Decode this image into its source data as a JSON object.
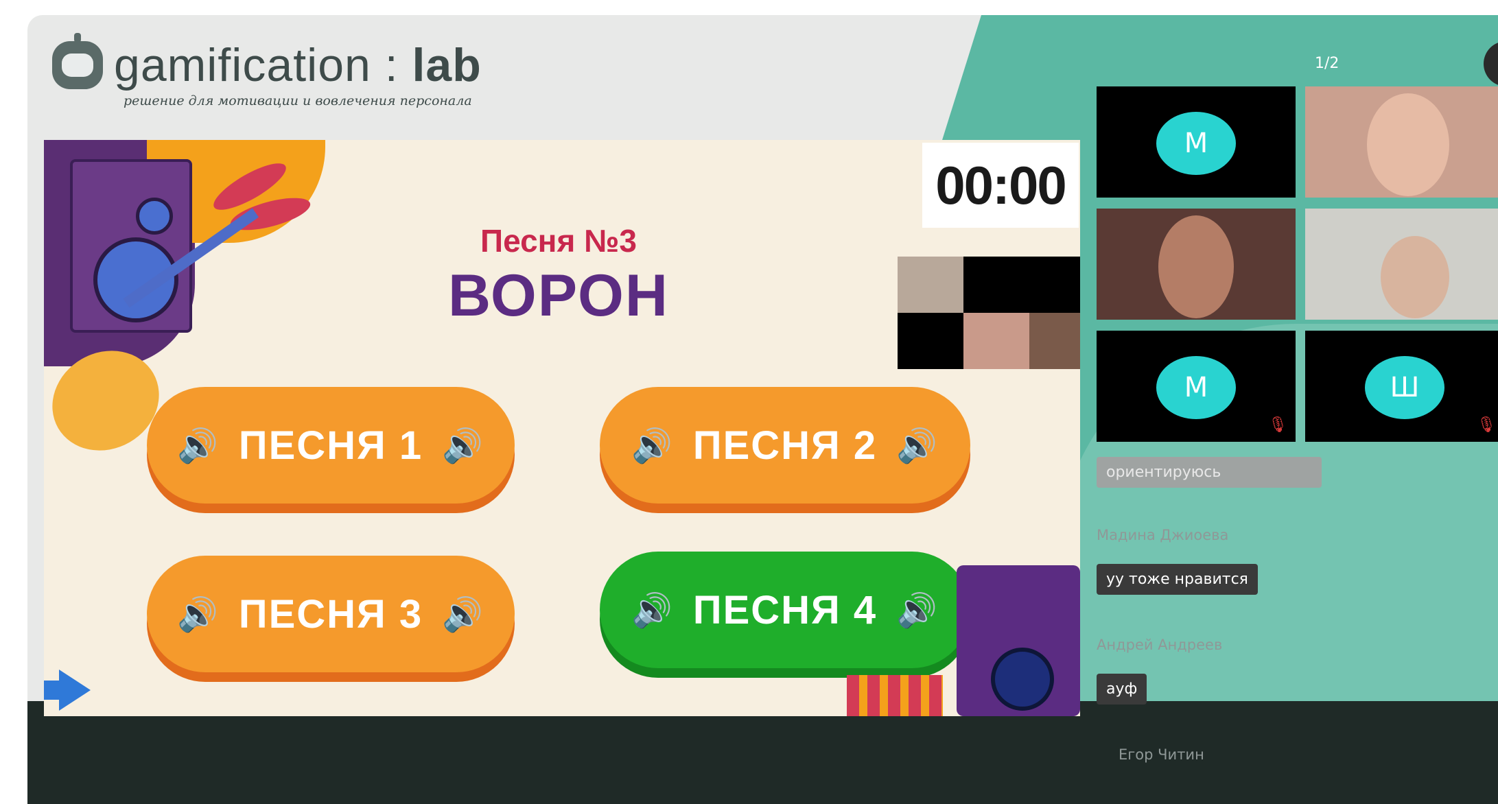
{
  "brand": {
    "name_part1": "gamification",
    "name_sep": " : ",
    "name_part2": "lab",
    "tagline": "решение для мотивации и вовлечения персонала"
  },
  "slide": {
    "timer": "00:00",
    "song_number": "Песня №3",
    "song_title": "ВОРОН",
    "speaker_glyph": "🔊",
    "buttons": [
      {
        "label": "ПЕСНЯ 1",
        "state": "default",
        "color": "#f59a2c"
      },
      {
        "label": "ПЕСНЯ 2",
        "state": "default",
        "color": "#f59a2c"
      },
      {
        "label": "ПЕСНЯ 3",
        "state": "default",
        "color": "#f59a2c"
      },
      {
        "label": "ПЕСНЯ 4",
        "state": "selected",
        "color": "#1fae2b"
      }
    ]
  },
  "pager": {
    "indicator": "1/2",
    "next_glyph": "›"
  },
  "participants": [
    {
      "initial": "М",
      "type": "avatar",
      "muted": false
    },
    {
      "initial": "",
      "type": "video",
      "muted": false
    },
    {
      "initial": "",
      "type": "video",
      "muted": false
    },
    {
      "initial": "",
      "type": "video",
      "muted": false
    },
    {
      "initial": "М",
      "type": "avatar",
      "muted": true
    },
    {
      "initial": "Ш",
      "type": "avatar",
      "muted": true
    }
  ],
  "chat": {
    "messages": [
      {
        "name": "",
        "text": "ориентируюсь"
      },
      {
        "name": "Мадина Джиоева",
        "text": "уу тоже нравится"
      },
      {
        "name": "Андрей Андреев",
        "text": "ауф"
      },
      {
        "name": "Егор Читин",
        "text": ""
      }
    ]
  },
  "icons": {
    "mute_glyph": "🎙"
  }
}
